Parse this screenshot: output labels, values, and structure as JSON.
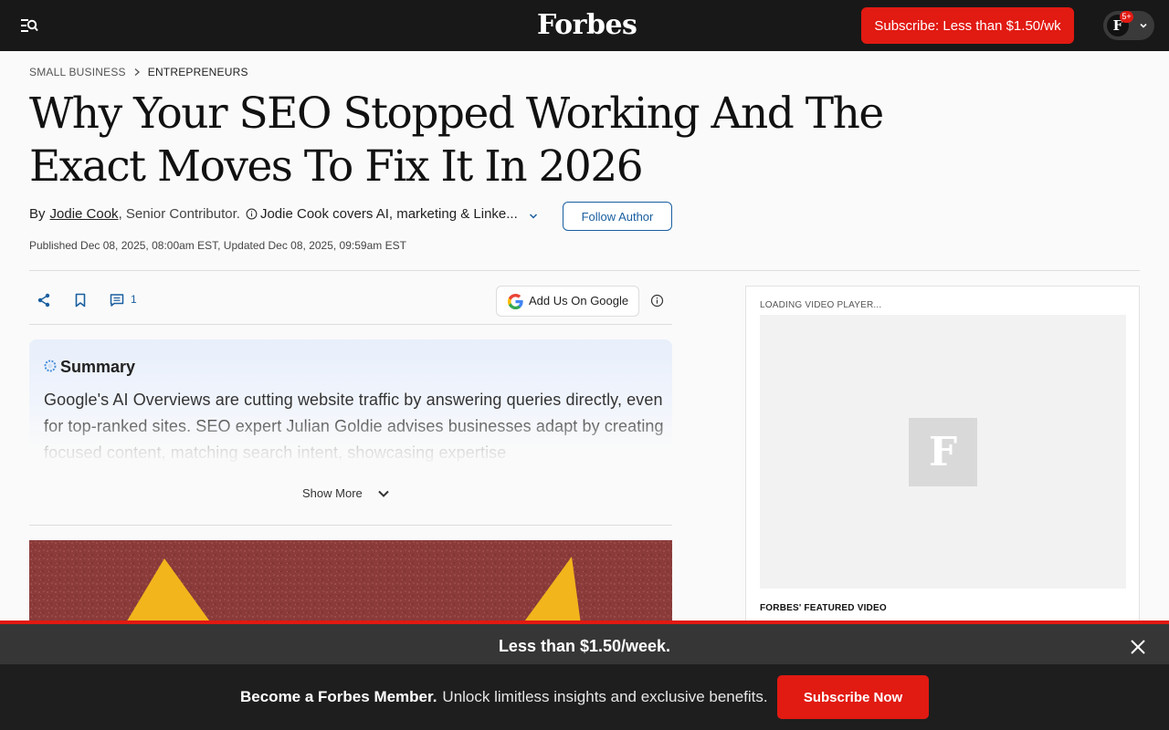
{
  "header": {
    "logo": "Forbes",
    "subscribe_label": "Subscribe: Less than $1.50/wk",
    "account_initial": "F",
    "notification_badge": "5+",
    "icons": {
      "menu": "menu-search-icon",
      "account_chevron": "chevron-down-icon"
    }
  },
  "breadcrumb": [
    "SMALL BUSINESS",
    "ENTREPRENEURS"
  ],
  "article": {
    "headline": "Why Your SEO Stopped Working And The Exact Moves To Fix It In 2026",
    "by_label": "By",
    "author": "Jodie Cook",
    "author_role": ", Senior Contributor.",
    "author_bio": "Jodie Cook covers AI, marketing & Linke...",
    "follow_label": "Follow Author",
    "published": "Published Dec 08, 2025, 08:00am EST, Updated Dec 08, 2025, 09:59am EST"
  },
  "actions": {
    "comment_count": "1",
    "google_label": "Add Us On Google",
    "icons": [
      "share-icon",
      "bookmark-icon",
      "comment-icon",
      "info-icon"
    ]
  },
  "summary": {
    "title": "Summary",
    "text": "Google's AI Overviews are cutting website traffic by answering queries directly, even for top-ranked sites. SEO expert Julian Goldie advises businesses adapt by creating focused content, matching search intent, showcasing expertise",
    "show_more_label": "Show More"
  },
  "video": {
    "loading_label": "LOADING VIDEO PLAYER...",
    "placeholder_letter": "F",
    "featured_label": "FORBES' FEATURED VIDEO"
  },
  "paywall": {
    "price_text": "Less than $1.50/week.",
    "promo_bold": "Become a Forbes Member.",
    "promo_text": "Unlock limitless insights and exclusive benefits.",
    "cta_label": "Subscribe Now"
  },
  "colors": {
    "brand_red": "#e11a12",
    "link_blue": "#1a5fa0",
    "header_bg": "#181818"
  }
}
